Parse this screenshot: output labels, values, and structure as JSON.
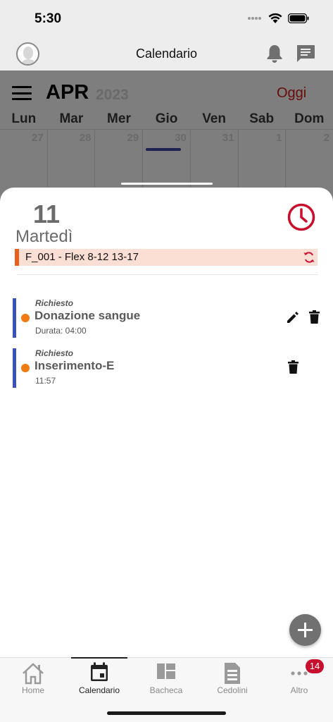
{
  "status_bar": {
    "time": "5:30"
  },
  "header": {
    "title": "Calendario"
  },
  "calendar": {
    "month": "APR",
    "year": "2023",
    "today_label": "Oggi",
    "weekdays": [
      "Lun",
      "Mar",
      "Mer",
      "Gio",
      "Ven",
      "Sab",
      "Dom"
    ],
    "days": [
      "27",
      "28",
      "29",
      "30",
      "31",
      "1",
      "2"
    ]
  },
  "detail": {
    "day_number": "11",
    "day_name": "Martedì",
    "shift": "F_001 - Flex 8-12 13-17",
    "events": [
      {
        "status": "Richiesto",
        "title": "Donazione sangue",
        "detail": "Durata: 04:00"
      },
      {
        "status": "Richiesto",
        "title": "Inserimento-E",
        "detail": "11:57"
      }
    ]
  },
  "tabs": [
    {
      "label": "Home"
    },
    {
      "label": "Calendario"
    },
    {
      "label": "Bacheca"
    },
    {
      "label": "Cedolini"
    },
    {
      "label": "Altro"
    }
  ],
  "altro_badge": "14",
  "colors": {
    "accent_red": "#c8102e",
    "event_stripe": "#3a52b5",
    "event_dot": "#ef7b12",
    "shift_bar": "#fbdfd4"
  }
}
